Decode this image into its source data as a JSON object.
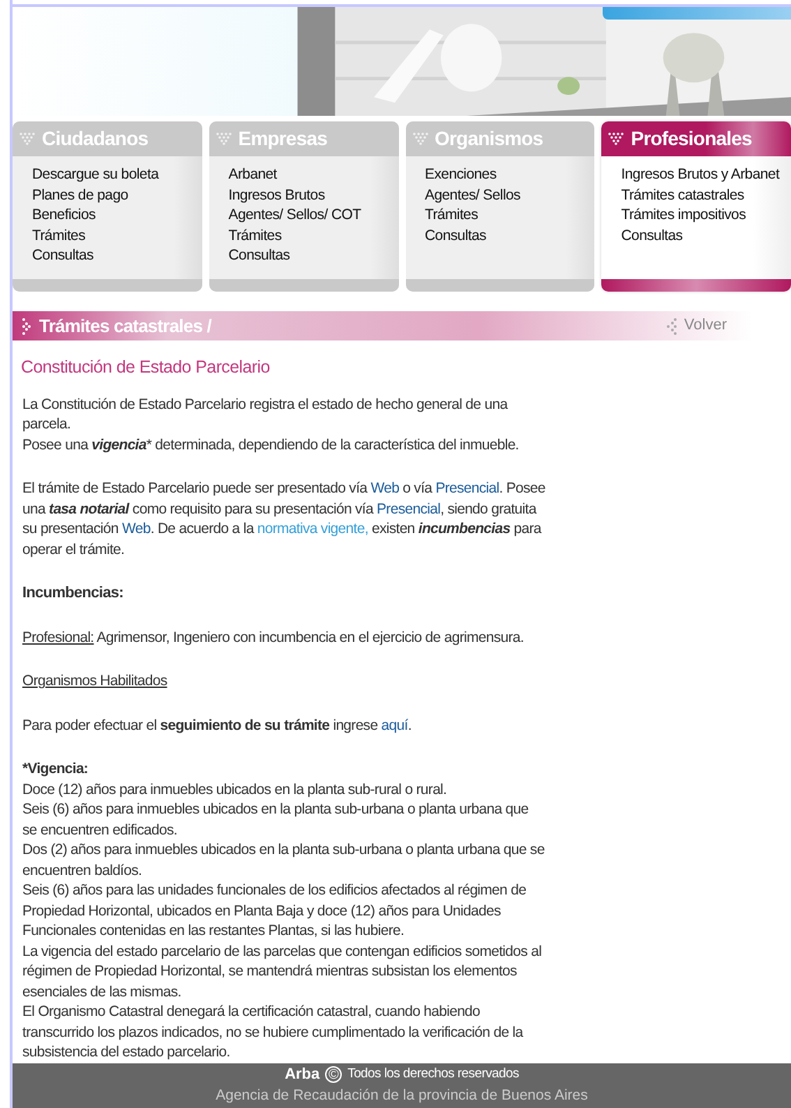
{
  "menu_groups": [
    {
      "title": "Ciudadanos",
      "selected": false,
      "items": [
        "Descargue su boleta",
        "Planes de pago",
        "Beneficios",
        "Trámites",
        "Consultas"
      ]
    },
    {
      "title": "Empresas",
      "selected": false,
      "items": [
        "Arbanet",
        "Ingresos Brutos",
        "Agentes/ Sellos/ COT",
        "Trámites",
        "Consultas"
      ]
    },
    {
      "title": "Organismos",
      "selected": false,
      "items": [
        "Exenciones",
        "Agentes/ Sellos",
        "Trámites",
        "Consultas"
      ]
    },
    {
      "title": "Profesionales",
      "selected": true,
      "items": [
        "Ingresos Brutos y Arbanet",
        "Trámites catastrales",
        "Trámites impositivos",
        "Consultas"
      ]
    }
  ],
  "breadcrumb": {
    "title": "Trámites catastrales /",
    "back": "Volver"
  },
  "heading": "Constitución de Estado Parcelario",
  "blocks": [
    {
      "kind": "para",
      "lines": [
        [
          {
            "text": "La Constitución de Estado Parcelario registra el estado de hecho general de una parcela."
          }
        ],
        [
          {
            "text": "Posee una "
          },
          {
            "text": "vigencia",
            "kind": "bolditalic"
          },
          {
            "text": "* determinada, dependiendo de la característica del inmueble."
          }
        ]
      ]
    },
    {
      "kind": "para",
      "lines": [
        [
          {
            "text": "El trámite de Estado Parcelario puede ser presentado vía "
          },
          {
            "text": "Web",
            "kind": "link"
          },
          {
            "text": " o vía "
          },
          {
            "text": "Presencial",
            "kind": "link"
          },
          {
            "text": ". Posee una "
          },
          {
            "text": "tasa notarial",
            "kind": "bolditalic"
          },
          {
            "text": " como requisito para su presentación vía "
          },
          {
            "text": "Presencial",
            "kind": "link"
          },
          {
            "text": ", siendo gratuita su presentación "
          },
          {
            "text": "Web",
            "kind": "link"
          },
          {
            "text": ". De acuerdo a la "
          },
          {
            "text": "normativa vigente,",
            "kind": "lightlink"
          },
          {
            "text": " existen "
          },
          {
            "text": "incumbencias",
            "kind": "bolditalic"
          },
          {
            "text": " para operar el trámite."
          }
        ]
      ]
    },
    {
      "kind": "title",
      "lines": [
        [
          {
            "text": "Incumbencias:"
          }
        ]
      ]
    },
    {
      "kind": "para",
      "lines": [
        [
          {
            "text": "Profesional:",
            "kind": "underline"
          },
          {
            "text": " Agrimensor, Ingeniero con incumbencia en el ejercicio de agrimensura."
          }
        ]
      ]
    },
    {
      "kind": "para",
      "lines": [
        [
          {
            "text": "Organismos Habilitados",
            "kind": "underline"
          }
        ]
      ]
    },
    {
      "kind": "para",
      "lines": [
        [
          {
            "text": "Para poder efectuar el "
          },
          {
            "text": "seguimiento de su trámite",
            "kind": "bold"
          },
          {
            "text": " ingrese "
          },
          {
            "text": "aquí",
            "kind": "link"
          },
          {
            "text": "."
          }
        ]
      ]
    },
    {
      "kind": "tight",
      "lines": [
        [
          {
            "text": "*Vigencia:",
            "kind": "bold"
          }
        ],
        [
          {
            "text": "Doce (12) años para inmuebles ubicados en la planta sub-rural o rural."
          }
        ],
        [
          {
            "text": "Seis (6) años para inmuebles ubicados en la planta sub-urbana o planta urbana que se encuentren edificados."
          }
        ],
        [
          {
            "text": "Dos (2) años para inmuebles ubicados en la planta sub-urbana o planta urbana que se encuentren baldíos."
          }
        ],
        [
          {
            "text": "Seis (6) años para las unidades funcionales de los edificios afectados al régimen de Propiedad Horizontal, ubicados en Planta Baja y doce (12) años para Unidades Funcionales contenidas en las restantes Plantas, si las hubiere."
          }
        ],
        [
          {
            "text": "La vigencia del estado parcelario de las parcelas que contengan edificios sometidos al régimen de Propiedad Horizontal, se mantendrá mientras subsistan los elementos esenciales de las mismas."
          }
        ],
        [
          {
            "text": "El Organismo Catastral denegará la certificación catastral, cuando habiendo transcurrido los plazos indicados, no se hubiere cumplimentado la verificación de la subsistencia del estado parcelario."
          }
        ]
      ]
    }
  ],
  "footer": {
    "brand": "Arba",
    "copyright": "©",
    "rights": "Todos los derechos reservados",
    "agency": "Agencia de Recaudación de la provincia de Buenos Aires"
  }
}
